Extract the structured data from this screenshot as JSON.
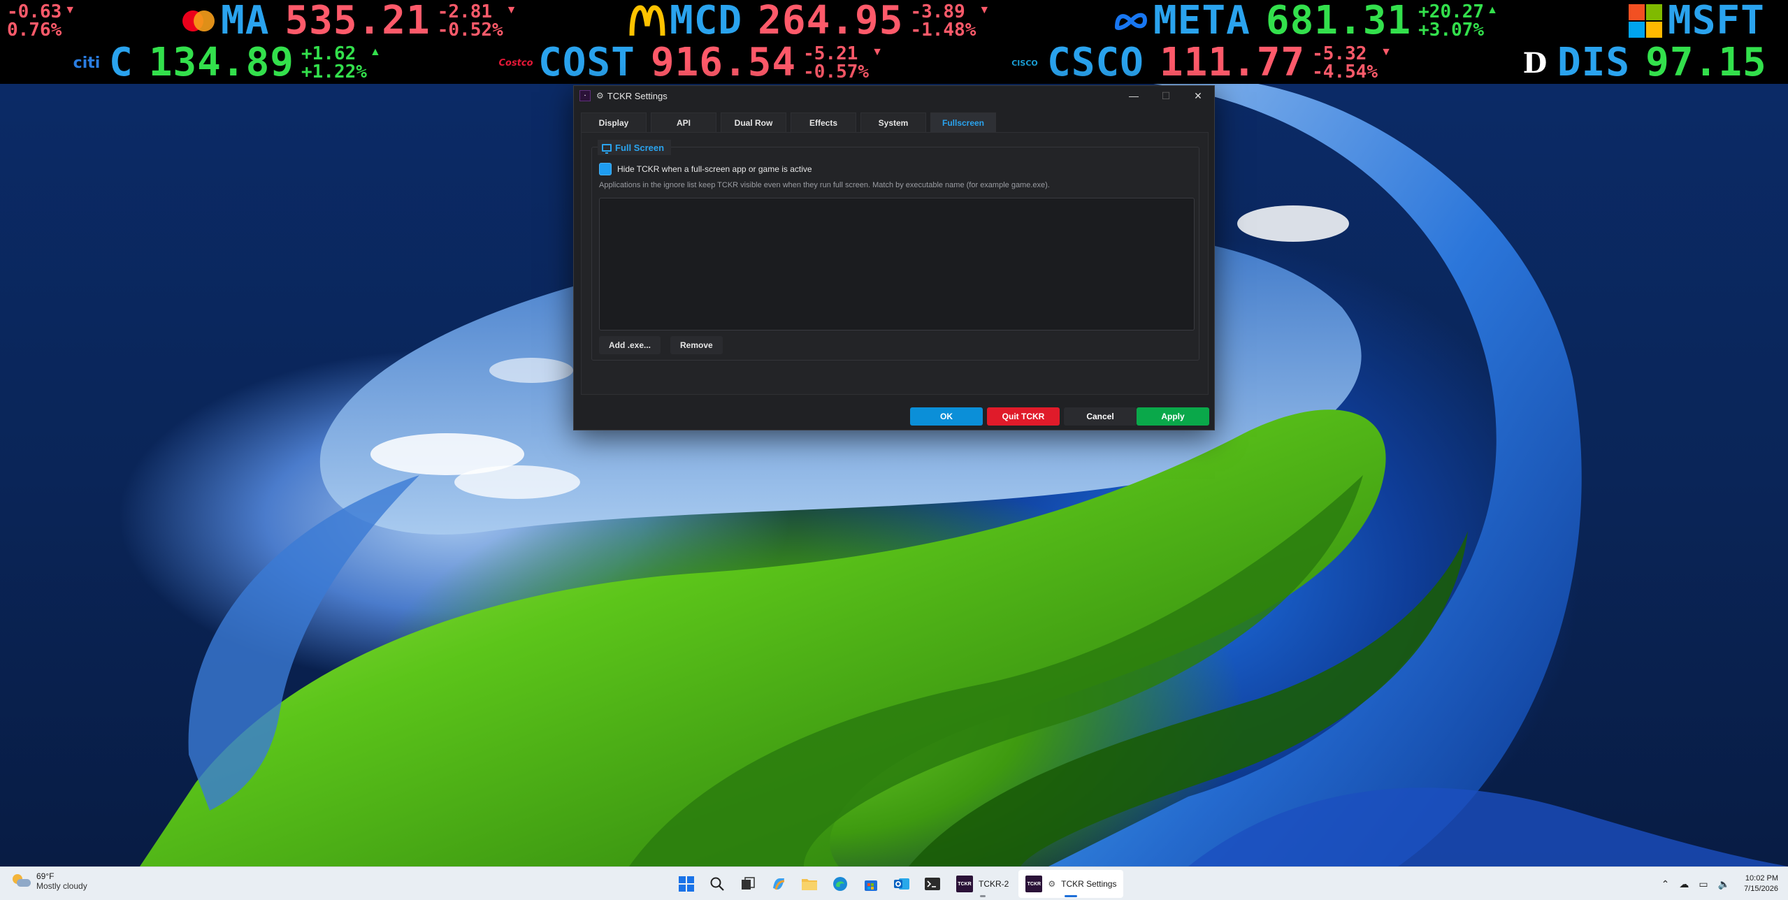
{
  "ticker": {
    "row1": [
      {
        "symbol": "",
        "price": "",
        "change": "-0.63",
        "pct": "0.76%",
        "dir": "down",
        "logo": ""
      },
      {
        "symbol": "MA",
        "price": "535.21",
        "change": "-2.81",
        "pct": "-0.52%",
        "dir": "down",
        "logo": "mastercard-logo"
      },
      {
        "symbol": "MCD",
        "price": "264.95",
        "change": "-3.89",
        "pct": "-1.48%",
        "dir": "down",
        "logo": "mcdonalds-logo"
      },
      {
        "symbol": "META",
        "price": "681.31",
        "change": "+20.27",
        "pct": "+3.07%",
        "dir": "up",
        "logo": "meta-logo"
      },
      {
        "symbol": "MSFT",
        "price": "",
        "change": "",
        "pct": "",
        "dir": "up",
        "logo": "microsoft-logo"
      }
    ],
    "row2": [
      {
        "symbol": "C",
        "price": "134.89",
        "change": "+1.62",
        "pct": "+1.22%",
        "dir": "up",
        "logo": "citi-logo",
        "logo_text": "citi"
      },
      {
        "symbol": "COST",
        "price": "916.54",
        "change": "-5.21",
        "pct": "-0.57%",
        "dir": "down",
        "logo": "costco-logo",
        "logo_text": "Costco"
      },
      {
        "symbol": "CSCO",
        "price": "111.77",
        "change": "-5.32",
        "pct": "-4.54%",
        "dir": "down",
        "logo": "cisco-logo",
        "logo_text": "CISCO"
      },
      {
        "symbol": "DIS",
        "price": "97.15",
        "change": "",
        "pct": "",
        "dir": "up",
        "logo": "disney-logo",
        "logo_text": "D"
      }
    ],
    "colors": {
      "up": "#33e04c",
      "down": "#ff5a6a",
      "symbol": "#2aa3ee"
    }
  },
  "dialog": {
    "title": "TCKR Settings",
    "tabs": [
      "Display",
      "API",
      "Dual Row",
      "Effects",
      "System",
      "Fullscreen"
    ],
    "active_tab": "Fullscreen",
    "group_title": "Full Screen",
    "hide_checkbox_label": "Hide TCKR when a full-screen app or game is active",
    "hide_checkbox_checked": true,
    "help_text": "Applications in the ignore list keep TCKR visible even when they run full screen. Match by executable name (for example game.exe).",
    "ignore_list": [],
    "add_label": "Add .exe...",
    "remove_label": "Remove",
    "ok_label": "OK",
    "quit_label": "Quit TCKR",
    "cancel_label": "Cancel",
    "apply_label": "Apply",
    "colors": {
      "ok": "#0b8fd8",
      "quit": "#e01b2a",
      "apply": "#0aa84a",
      "accent": "#2aa3ee"
    }
  },
  "taskbar": {
    "weather_temp": "69°F",
    "weather_cond": "Mostly cloudy",
    "apps": [
      {
        "name": "start-button",
        "icon": "windows-logo-icon"
      },
      {
        "name": "search-button",
        "icon": "search-icon"
      },
      {
        "name": "task-view-button",
        "icon": "task-view-icon"
      },
      {
        "name": "copilot-button",
        "icon": "copilot-icon"
      },
      {
        "name": "file-explorer-button",
        "icon": "folder-icon"
      },
      {
        "name": "edge-button",
        "icon": "edge-icon"
      },
      {
        "name": "store-button",
        "icon": "store-icon"
      },
      {
        "name": "outlook-button",
        "icon": "outlook-icon"
      },
      {
        "name": "terminal-button",
        "icon": "terminal-icon"
      }
    ],
    "tckr2_label": "TCKR-2",
    "settings_label": "TCKR Settings",
    "badge_text": "TCKR",
    "time": "10:02 PM",
    "date": "7/15/2026"
  }
}
